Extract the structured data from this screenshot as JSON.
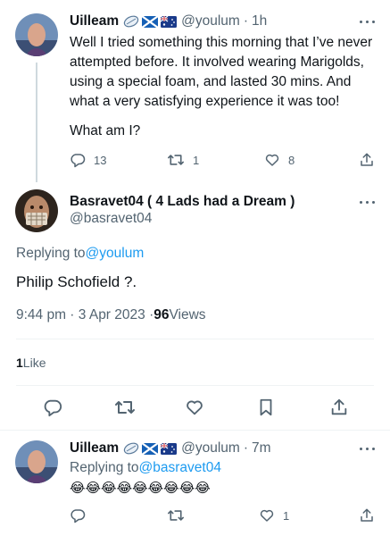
{
  "tweet1": {
    "author": "Uilleam",
    "handle": "@youlum",
    "sep": "·",
    "time": "1h",
    "text": "Well I tried something this morning that I’ve never attempted before. It involved wearing Marigolds, using a special foam, and lasted 30 mins. And what a very satisfying experience it was too!",
    "text2": "What am I?",
    "replies": "13",
    "retweets": "1",
    "likes": "8"
  },
  "main": {
    "author": "Basravet04 ( 4 Lads had a Dream )",
    "handle": "@basravet04",
    "replying_prefix": "Replying to ",
    "replying_to": "@youlum",
    "text": "Philip Schofield ?.",
    "timestamp": "9:44 pm · 3 Apr 2023 · ",
    "views_count": "96",
    "views_label": " Views",
    "likes_count": "1",
    "likes_label": " Like"
  },
  "reply": {
    "author": "Uilleam",
    "handle": "@youlum",
    "sep": "·",
    "time": "7m",
    "replying_prefix": "Replying to ",
    "replying_to": "@basravet04",
    "emojis": "😂😂😂😂😂😂😂😂😂",
    "likes": "1"
  },
  "icons": [
    "rugby-ball-icon",
    "scotland-flag-icon",
    "australia-flag-icon",
    "reply-icon",
    "retweet-icon",
    "like-icon",
    "bookmark-icon",
    "share-icon",
    "more-icon"
  ],
  "colors": {
    "link": "#1d9bf0",
    "secondary_text": "#536471",
    "text": "#0f1419",
    "divider": "#eff3f4"
  }
}
